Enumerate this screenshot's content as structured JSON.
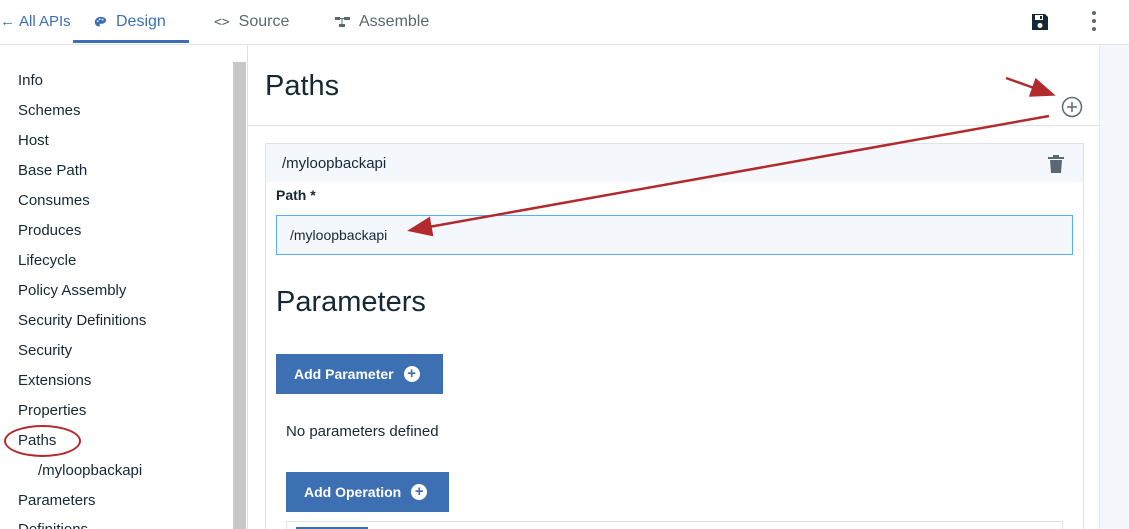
{
  "topbar": {
    "back_label": "All APIs",
    "tabs": [
      {
        "label": "Design",
        "icon": "palette-icon",
        "active": true
      },
      {
        "label": "Source",
        "icon": "code-icon",
        "active": false
      },
      {
        "label": "Assemble",
        "icon": "assemble-icon",
        "active": false
      }
    ]
  },
  "sidebar": {
    "items": [
      {
        "label": "Info"
      },
      {
        "label": "Schemes"
      },
      {
        "label": "Host"
      },
      {
        "label": "Base Path"
      },
      {
        "label": "Consumes"
      },
      {
        "label": "Produces"
      },
      {
        "label": "Lifecycle"
      },
      {
        "label": "Policy Assembly"
      },
      {
        "label": "Security Definitions"
      },
      {
        "label": "Security"
      },
      {
        "label": "Extensions"
      },
      {
        "label": "Properties"
      },
      {
        "label": "Paths"
      },
      {
        "label": "/myloopbackapi"
      },
      {
        "label": "Parameters"
      },
      {
        "label": "Definitions"
      }
    ]
  },
  "main": {
    "title": "Paths",
    "path_card": {
      "header": "/myloopbackapi",
      "path_label": "Path *",
      "path_value": "/myloopbackapi"
    },
    "parameters_title": "Parameters",
    "add_parameter_label": "Add Parameter",
    "no_params_text": "No parameters defined",
    "add_operation_label": "Add Operation"
  },
  "colors": {
    "accent": "#3d70b2",
    "annotation": "#b22a2e",
    "input_border": "#5aaafa"
  }
}
